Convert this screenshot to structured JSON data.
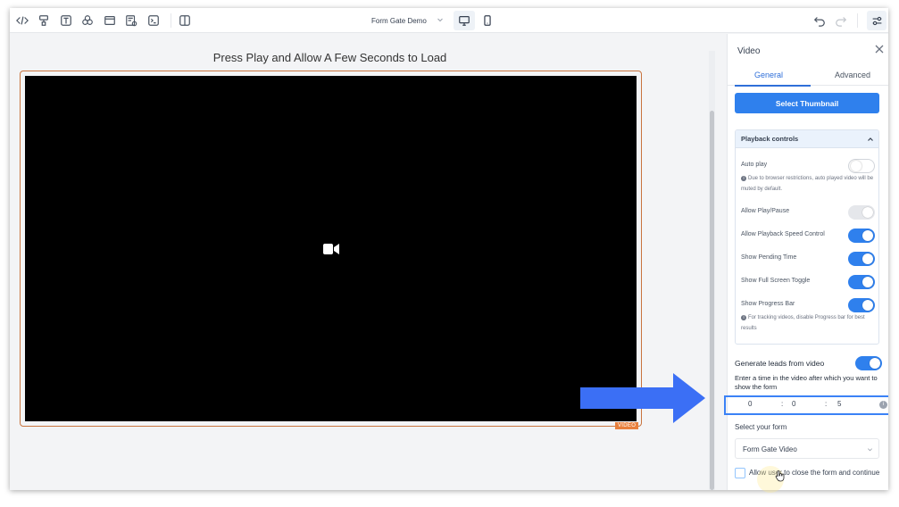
{
  "toolbar": {
    "page_name": "Form Gate Demo",
    "left_icons": [
      "code-icon",
      "paint-roller-icon",
      "text-icon",
      "shapes-icon",
      "layout-icon",
      "form-icon",
      "terminal-icon",
      "columns-icon"
    ],
    "devices": [
      "desktop-icon",
      "mobile-icon"
    ]
  },
  "canvas": {
    "heading": "Press Play and Allow A Few Seconds to Load",
    "video_tag": "VIDEO"
  },
  "panel": {
    "title": "Video",
    "tabs": {
      "general": "General",
      "advanced": "Advanced",
      "active": "General"
    },
    "select_thumbnail": "Select Thumbnail",
    "playback_controls": {
      "title": "Playback controls",
      "auto_play": {
        "label": "Auto play",
        "enabled": false
      },
      "auto_play_note": "Due to browser restrictions, auto played video will be muted by default.",
      "allow_play_pause": {
        "label": "Allow Play/Pause",
        "enabled": true,
        "disabled": true
      },
      "allow_speed_control": {
        "label": "Allow Playback Speed Control",
        "enabled": true
      },
      "show_pending_time": {
        "label": "Show Pending Time",
        "enabled": true
      },
      "show_full_screen": {
        "label": "Show Full Screen Toggle",
        "enabled": true
      },
      "show_progress_bar": {
        "label": "Show Progress Bar",
        "enabled": true
      },
      "progress_note": "For tracking videos, disable Progress bar for best results"
    },
    "generate_leads": {
      "label": "Generate leads from video",
      "enabled": true
    },
    "time_description": "Enter a time in the video after which you want to show the form",
    "time": {
      "hours": "0",
      "minutes": "0",
      "seconds": "5",
      "separator": ":"
    },
    "select_form_label": "Select your form",
    "selected_form": "Form Gate Video",
    "allow_close": {
      "label": "Allow user to close the form and continue",
      "checked": false
    }
  },
  "colors": {
    "accent": "#2f80ed",
    "annotation_arrow": "#3b6ff5",
    "video_border": "#c8743f"
  }
}
